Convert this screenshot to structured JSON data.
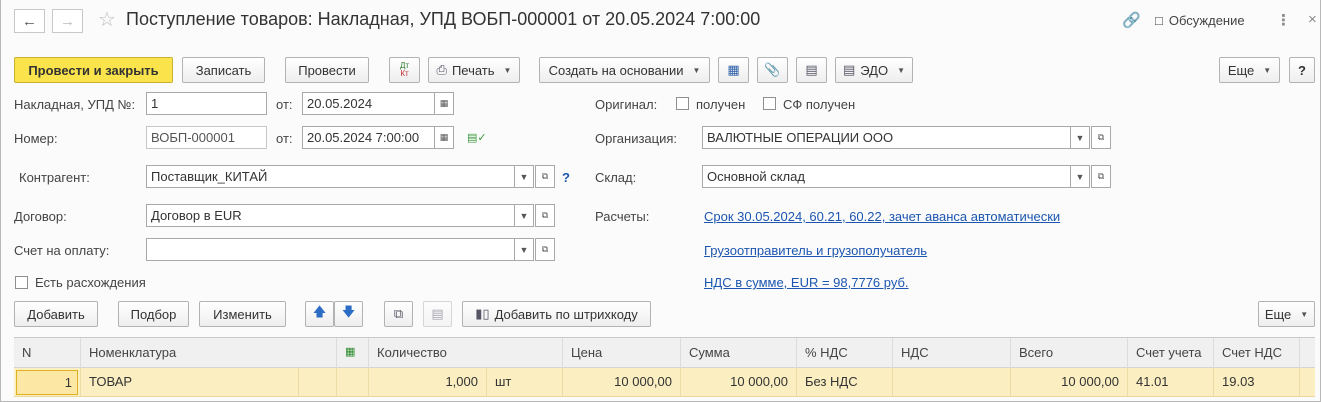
{
  "window": {
    "title": "Поступление товаров: Накладная, УПД ВОБП-000001 от 20.05.2024 7:00:00",
    "discussion_label": "Обсуждение"
  },
  "toolbar": {
    "post_and_close": "Провести и закрыть",
    "save": "Записать",
    "post": "Провести",
    "dt_kt": "Дт Кт",
    "print": "Печать",
    "create_based_on": "Создать на основании",
    "edo": "ЭДО",
    "more": "Еще",
    "help": "?"
  },
  "form": {
    "invoice_label": "Накладная, УПД №:",
    "invoice_number": "1",
    "from_label": "от:",
    "invoice_date": "20.05.2024",
    "number_label": "Номер:",
    "number": "ВОБП-000001",
    "number_date": "20.05.2024  7:00:00",
    "counterparty_label": "Контрагент:",
    "counterparty": "Поставщик_КИТАЙ",
    "contract_label": "Договор:",
    "contract": "Договор в EUR",
    "payment_invoice_label": "Счет на оплату:",
    "payment_invoice": "",
    "discrepancies_label": "Есть расхождения",
    "original_label": "Оригинал:",
    "received_label": "получен",
    "sf_received_label": "СФ получен",
    "organization_label": "Организация:",
    "organization": "ВАЛЮТНЫЕ ОПЕРАЦИИ ООО",
    "warehouse_label": "Склад:",
    "warehouse": "Основной склад",
    "settlements_label": "Расчеты:",
    "settlements_link": "Срок 30.05.2024, 60.21, 60.22, зачет аванса автоматически",
    "shipper_link": "Грузоотправитель и грузополучатель",
    "vat_link": "НДС в сумме, EUR = 98,7776 руб.",
    "help_mark": "?"
  },
  "table_toolbar": {
    "add": "Добавить",
    "selection": "Подбор",
    "change": "Изменить",
    "add_by_barcode": "Добавить по штрихкоду",
    "more": "Еще"
  },
  "table": {
    "columns": [
      "N",
      "Номенклатура",
      "Количество",
      "Цена",
      "Сумма",
      "% НДС",
      "НДС",
      "Всего",
      "Счет учета",
      "Счет НДС"
    ],
    "rows": [
      {
        "n": "1",
        "item": "ТОВАР",
        "qty": "1,000",
        "unit": "шт",
        "price": "10 000,00",
        "sum": "10 000,00",
        "vat_rate": "Без НДС",
        "vat": "",
        "total": "10 000,00",
        "account": "41.01",
        "vat_account": "19.03"
      }
    ]
  },
  "colors": {
    "primary_button": "#fbe34b",
    "link": "#1c56b0",
    "selected_row": "#fbefc2"
  }
}
